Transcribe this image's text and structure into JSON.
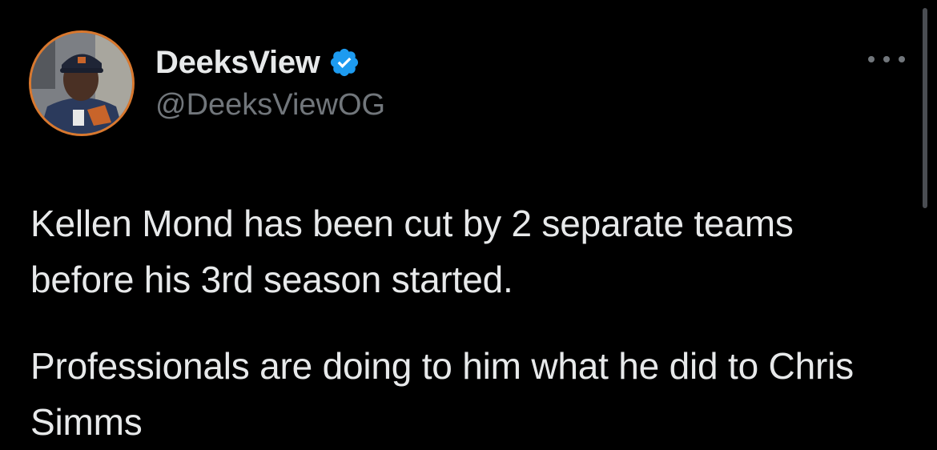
{
  "tweet": {
    "author": {
      "display_name": "DeeksView",
      "handle": "@DeeksViewOG",
      "verified": true,
      "avatar_ring_color": "#d9782e"
    },
    "text_paragraphs": [
      "Kellen Mond has been cut by 2 separate teams\nbefore his 3rd season started.",
      "Professionals are doing to him what he did to Chris Simms"
    ],
    "menu_icon": "more-horizontal-icon"
  },
  "colors": {
    "background": "#000000",
    "primary_text": "#e7e9ea",
    "secondary_text": "#71767b",
    "verified_badge": "#1d9bf0"
  }
}
